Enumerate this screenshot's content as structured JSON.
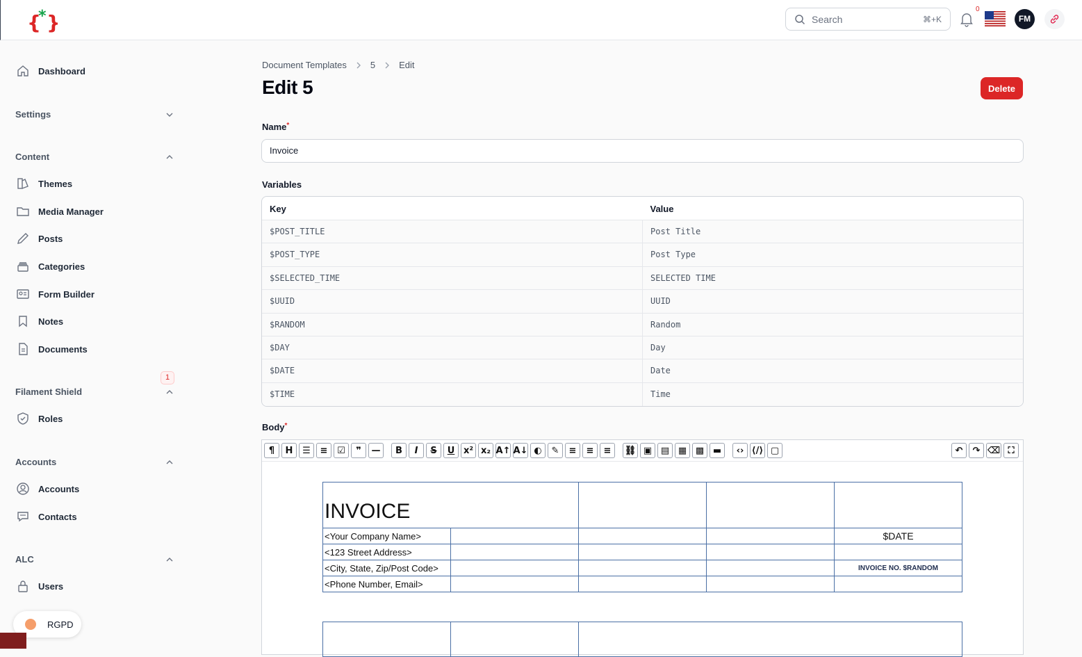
{
  "header": {
    "search_placeholder": "Search",
    "search_shortcut": "⌘+K",
    "notifications_count": "0",
    "avatar_initials": "FM"
  },
  "sidebar": {
    "dashboard": "Dashboard",
    "settings_group": "Settings",
    "content_group": "Content",
    "content_items": [
      "Themes",
      "Media Manager",
      "Posts",
      "Categories",
      "Form Builder",
      "Notes",
      "Documents"
    ],
    "shield_group": "Filament Shield",
    "roles": "Roles",
    "roles_badge": "1",
    "accounts_group": "Accounts",
    "accounts_items": [
      "Accounts",
      "Contacts"
    ],
    "alc_group": "ALC",
    "users": "Users",
    "rgpd": "RGPD"
  },
  "page": {
    "breadcrumb": [
      "Document Templates",
      "5",
      "Edit"
    ],
    "title": "Edit 5",
    "delete_label": "Delete",
    "name_label": "Name",
    "name_value": "Invoice",
    "variables_label": "Variables",
    "body_label": "Body"
  },
  "variables": {
    "headers": [
      "Key",
      "Value"
    ],
    "rows": [
      [
        "$POST_TITLE",
        "Post Title"
      ],
      [
        "$POST_TYPE",
        "Post Type"
      ],
      [
        "$SELECTED_TIME",
        "SELECTED TIME"
      ],
      [
        "$UUID",
        "UUID"
      ],
      [
        "$RANDOM",
        "Random"
      ],
      [
        "$DAY",
        "Day"
      ],
      [
        "$DATE",
        "Date"
      ],
      [
        "$TIME",
        "Time"
      ]
    ]
  },
  "document": {
    "heading": "INVOICE",
    "company_lines": [
      "<Your Company Name>",
      "<123 Street Address>",
      "<City, State, Zip/Post Code>",
      "<Phone Number, Email>"
    ],
    "date_var": "$DATE",
    "invoice_no": "INVOICE NO. $RANDOM"
  },
  "colors": {
    "danger": "#dc2626",
    "brand_red": "#e11d48",
    "brand_green": "#16a34a"
  }
}
